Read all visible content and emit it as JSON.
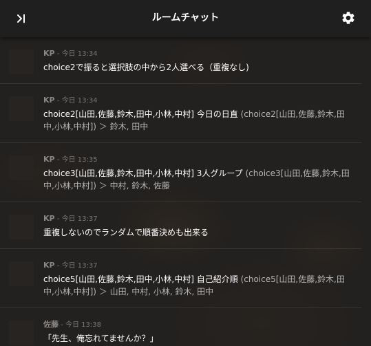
{
  "header": {
    "title": "ルームチャット"
  },
  "messages": [
    {
      "name": "KP",
      "time": "- 今日 13:34",
      "text": "choice2で振ると選択肢の中から2人選べる（重複なし)",
      "result": ""
    },
    {
      "name": "KP",
      "time": "- 今日 13:34",
      "text": "choice2[山田,佐藤,鈴木,田中,小林,中村] 今日の日直 ",
      "result": "(choice2[山田,佐藤,鈴木,田中,小林,中村]) ＞ 鈴木, 田中"
    },
    {
      "name": "KP",
      "time": "- 今日 13:35",
      "text": "choice3[山田,佐藤,鈴木,田中,小林,中村] 3人グループ ",
      "result": "(choice3[山田,佐藤,鈴木,田中,小林,中村]) ＞ 中村, 鈴木, 佐藤"
    },
    {
      "name": "KP",
      "time": "- 今日 13:37",
      "text": "重複しないのでランダムで順番決めも出来る",
      "result": ""
    },
    {
      "name": "KP",
      "time": "- 今日 13:37",
      "text": "choice5[山田,佐藤,鈴木,田中,小林,中村] 自己紹介順 ",
      "result": "(choice5[山田,佐藤,鈴木,田中,小林,中村]) ＞ 山田, 中村, 小林, 鈴木, 田中"
    },
    {
      "name": "佐藤",
      "time": "- 今日 13:38",
      "text": "「先生、俺忘れてませんか？」",
      "result": ""
    }
  ]
}
